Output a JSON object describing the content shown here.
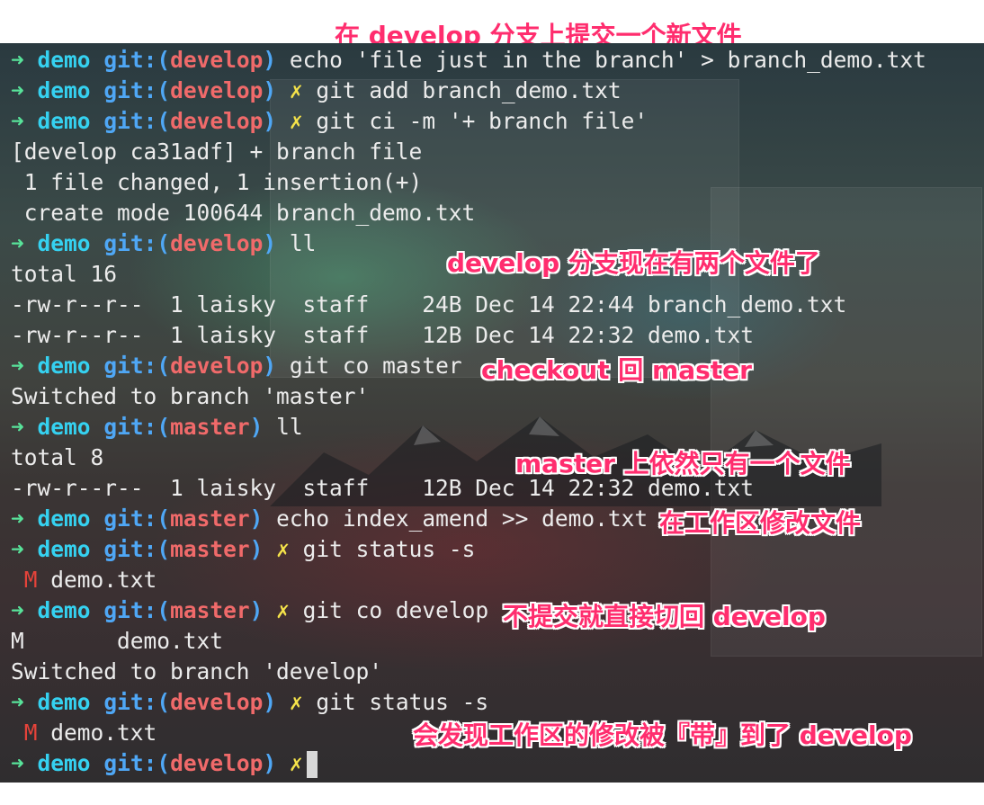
{
  "top_note": "在 develop 分支上提交一个新文件",
  "prompt": {
    "arrow": "➜",
    "dir": "demo",
    "git": "git:",
    "open": "(",
    "close": ")",
    "dirty": "✗"
  },
  "lines": [
    {
      "branch": "develop",
      "dirty": false,
      "cmd": "echo 'file just in the branch' > branch_demo.txt"
    },
    {
      "branch": "develop",
      "dirty": true,
      "cmd": "git add branch_demo.txt"
    },
    {
      "branch": "develop",
      "dirty": true,
      "cmd": "git ci -m '+ branch file'"
    },
    {
      "text": "[develop ca31adf] + branch file"
    },
    {
      "text": " 1 file changed, 1 insertion(+)"
    },
    {
      "text": " create mode 100644 branch_demo.txt"
    },
    {
      "branch": "develop",
      "dirty": false,
      "cmd": "ll"
    },
    {
      "text": "total 16"
    },
    {
      "text": "-rw-r--r--  1 laisky  staff    24B Dec 14 22:44 branch_demo.txt"
    },
    {
      "text": "-rw-r--r--  1 laisky  staff    12B Dec 14 22:32 demo.txt"
    },
    {
      "branch": "develop",
      "dirty": false,
      "cmd": "git co master"
    },
    {
      "text": "Switched to branch 'master'"
    },
    {
      "branch": "master",
      "dirty": false,
      "cmd": "ll"
    },
    {
      "text": "total 8"
    },
    {
      "text": "-rw-r--r--  1 laisky  staff    12B Dec 14 22:32 demo.txt"
    },
    {
      "branch": "master",
      "dirty": false,
      "cmd": "echo index_amend >> demo.txt"
    },
    {
      "branch": "master",
      "dirty": true,
      "cmd": "git status -s"
    },
    {
      "mod": "M",
      "file": "demo.txt"
    },
    {
      "branch": "master",
      "dirty": true,
      "cmd": "git co develop"
    },
    {
      "text": "M       demo.txt"
    },
    {
      "text": "Switched to branch 'develop'"
    },
    {
      "branch": "develop",
      "dirty": true,
      "cmd": "git status -s"
    },
    {
      "mod": "M",
      "file": "demo.txt"
    },
    {
      "branch": "develop",
      "dirty": true,
      "cmd": "",
      "cursor": true
    }
  ],
  "annotations": [
    "develop 分支现在有两个文件了",
    "checkout 回 master",
    "master 上依然只有一个文件",
    "在工作区修改文件",
    "不提交就直接切回 develop",
    "会发现工作区的修改被『带』到了 develop"
  ]
}
